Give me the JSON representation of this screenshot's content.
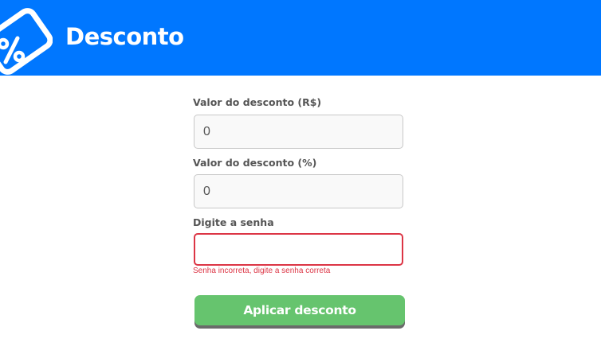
{
  "header": {
    "title": "Desconto",
    "logo_icon": "discount-tag-icon",
    "background_color": "#0077ff"
  },
  "form": {
    "fields": [
      {
        "label": "Valor do desconto (R$)",
        "value": "0",
        "placeholder": ""
      },
      {
        "label": "Valor do desconto (%)",
        "value": "0",
        "placeholder": ""
      },
      {
        "label": "Digite a senha",
        "value": "",
        "placeholder": ""
      }
    ],
    "password_error": "Senha incorreta, digite a senha correta",
    "submit_label": "Aplicar desconto"
  },
  "colors": {
    "error": "#dc3545",
    "button": "#66c46e",
    "button_shadow": "#6a6a6a"
  }
}
